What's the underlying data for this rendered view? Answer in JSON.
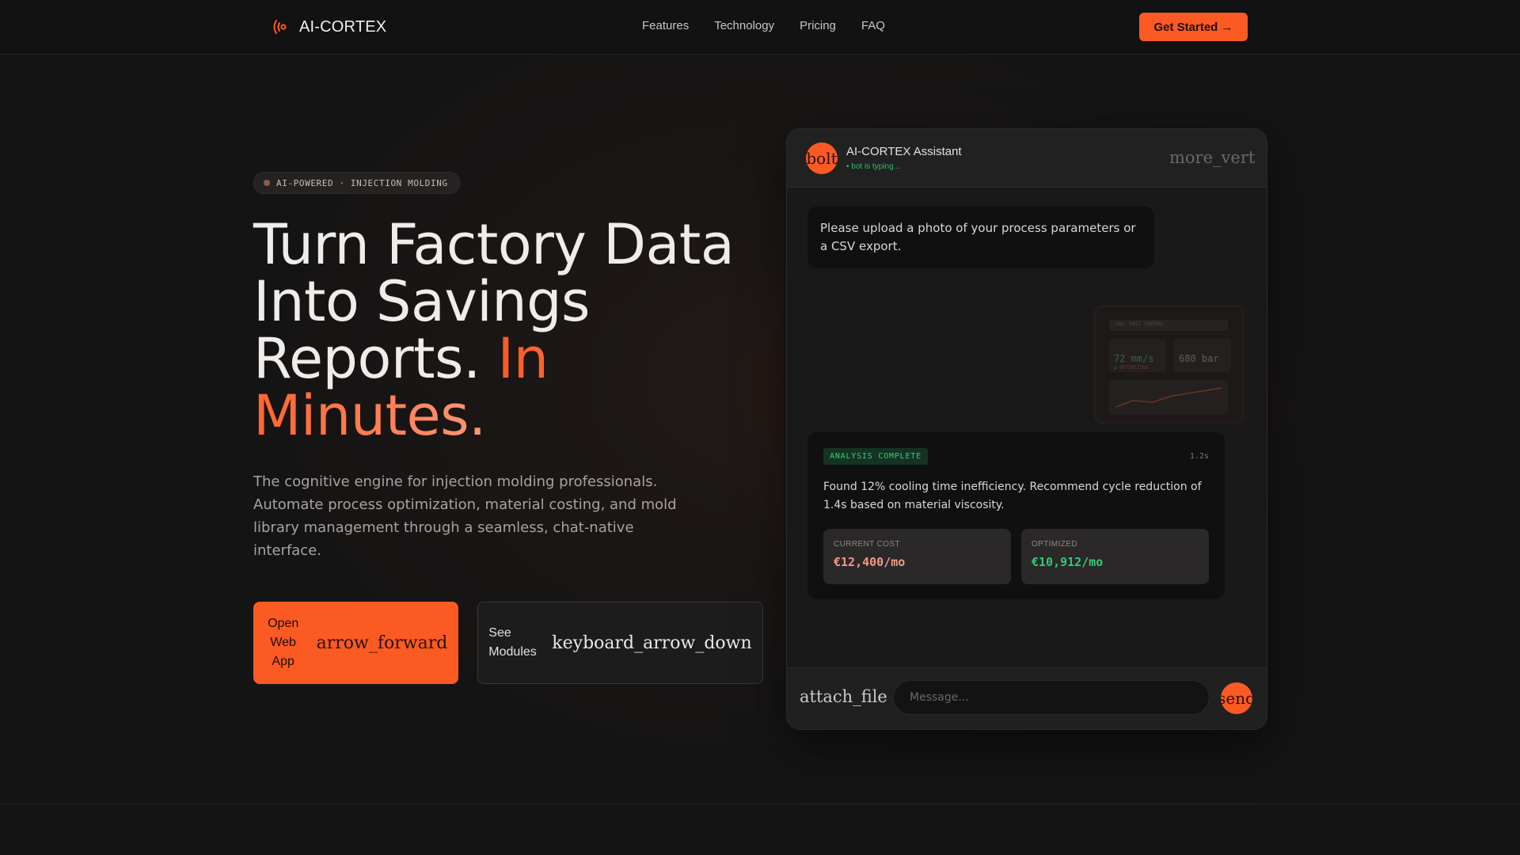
{
  "brand": {
    "name": "AI-CORTEX",
    "logo_icon": "broadcast-signal-icon",
    "accent": "#fc5a23"
  },
  "nav": {
    "links": [
      "Features",
      "Technology",
      "Pricing",
      "FAQ"
    ],
    "cta_label": "Get Started →"
  },
  "hero": {
    "badge": "AI-POWERED · INJECTION MOLDING",
    "title_main": "Turn Factory Data Into Savings Reports. ",
    "title_accent": "In Minutes.",
    "subtitle": "The cognitive engine for injection molding professionals. Automate process optimization, material costing, and mold library management through a seamless, chat-native interface.",
    "primary_label": "Open Web App",
    "primary_icon": "arrow_forward",
    "secondary_label": "See Modules",
    "secondary_icon": "keyboard_arrow_down"
  },
  "chat": {
    "avatar_icon": "bolt",
    "assistant_name": "AI-CORTEX Assistant",
    "status": "• bot is typing...",
    "menu_icon": "more_vert",
    "message": "Please upload a photo of your process parameters or a CSV export.",
    "upload": {
      "header": "INJ. UNIT CONTROL",
      "speed": "72 mm/s",
      "speed_status": "▲ OPTIMIZING",
      "pressure": "680 bar"
    },
    "analysis": {
      "tag": "ANALYSIS COMPLETE",
      "time": "1.2s",
      "finding": "Found 12% cooling time inefficiency. Recommend cycle reduction of 1.4s based on material viscosity.",
      "current_label": "CURRENT COST",
      "current_value": "€12,400/mo",
      "optimized_label": "OPTIMIZED",
      "optimized_value": "€10,912/mo",
      "current_color": "#f09a86",
      "optimized_color": "#33c878"
    },
    "attach_icon": "attach_file",
    "input_placeholder": "Message...",
    "send_icon": "send"
  }
}
